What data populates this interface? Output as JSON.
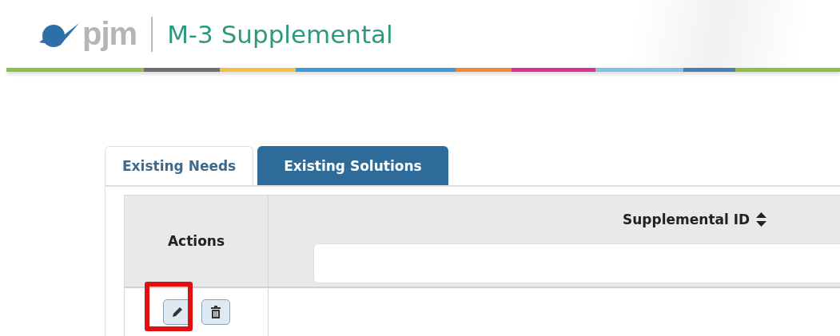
{
  "header": {
    "logo": "pjm",
    "title": "M-3 Supplemental"
  },
  "tabs": [
    {
      "label": "Existing Needs",
      "selected": false
    },
    {
      "label": "Existing Solutions",
      "selected": true
    }
  ],
  "table": {
    "columns": [
      {
        "label": "Actions",
        "sortable": false,
        "filter": false
      },
      {
        "label": "Supplemental ID",
        "sortable": true,
        "filter": true
      }
    ],
    "rows": [
      {
        "actions": [
          {
            "kind": "edit",
            "highlighted": true
          },
          {
            "kind": "delete",
            "highlighted": false
          }
        ]
      }
    ]
  }
}
